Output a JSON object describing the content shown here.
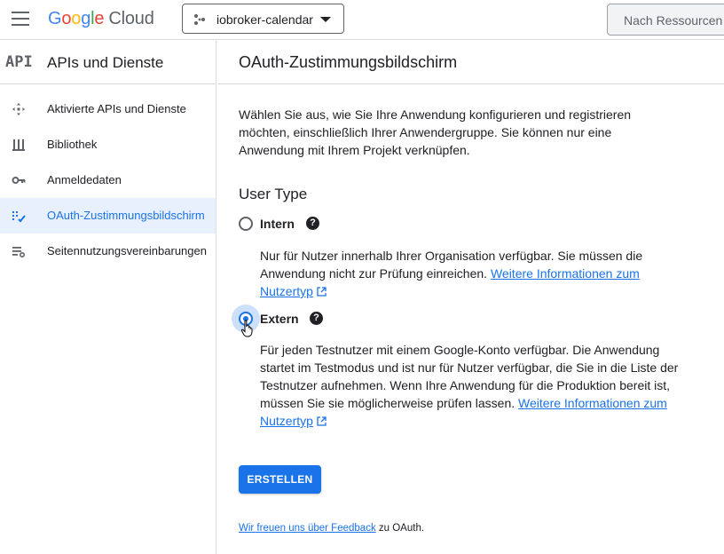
{
  "header": {
    "logo": {
      "g": "G",
      "o1": "o",
      "o2": "o",
      "g2": "g",
      "l": "l",
      "e": "e",
      "cloud": "Cloud"
    },
    "project": "iobroker-calendar",
    "search_placeholder": "Nach Ressourcen"
  },
  "sidebar": {
    "logo_text": "API",
    "title": "APIs und Dienste",
    "items": [
      {
        "label": "Aktivierte APIs und Dienste",
        "icon": "diamond-arrows-icon"
      },
      {
        "label": "Bibliothek",
        "icon": "library-icon"
      },
      {
        "label": "Anmeldedaten",
        "icon": "key-icon"
      },
      {
        "label": "OAuth-Zustimmungsbildschirm",
        "icon": "consent-screen-icon",
        "active": true
      },
      {
        "label": "Seitennutzungsvereinbarungen",
        "icon": "settings-list-icon"
      }
    ]
  },
  "main": {
    "title": "OAuth-Zustimmungsbildschirm",
    "intro": "Wählen Sie aus, wie Sie Ihre Anwendung konfigurieren und registrieren möchten, einschließlich Ihrer Anwendergruppe. Sie können nur eine Anwendung mit Ihrem Projekt verknüpfen.",
    "user_type_title": "User Type",
    "options": {
      "intern": {
        "label": "Intern",
        "description": "Nur für Nutzer innerhalb Ihrer Organisation verfügbar. Sie müssen die Anwendung nicht zur Prüfung einreichen.",
        "link": "Weitere Informationen zum Nutzertyp",
        "checked": false
      },
      "extern": {
        "label": "Extern",
        "description": "Für jeden Testnutzer mit einem Google-Konto verfügbar. Die Anwendung startet im Testmodus und ist nur für Nutzer verfügbar, die Sie in die Liste der Testnutzer aufnehmen. Wenn Ihre Anwendung für die Produktion bereit ist, müssen Sie sie möglicherweise prüfen lassen.",
        "link": "Weitere Informationen zum Nutzertyp",
        "checked": true
      }
    },
    "help_glyph": "?",
    "create_button": "ERSTELLEN",
    "feedback_link": "Wir freuen uns über Feedback",
    "feedback_suffix": " zu OAuth."
  },
  "colors": {
    "accent": "#1a73e8",
    "active_bg": "#e8f0fe",
    "border": "#dadce0"
  }
}
